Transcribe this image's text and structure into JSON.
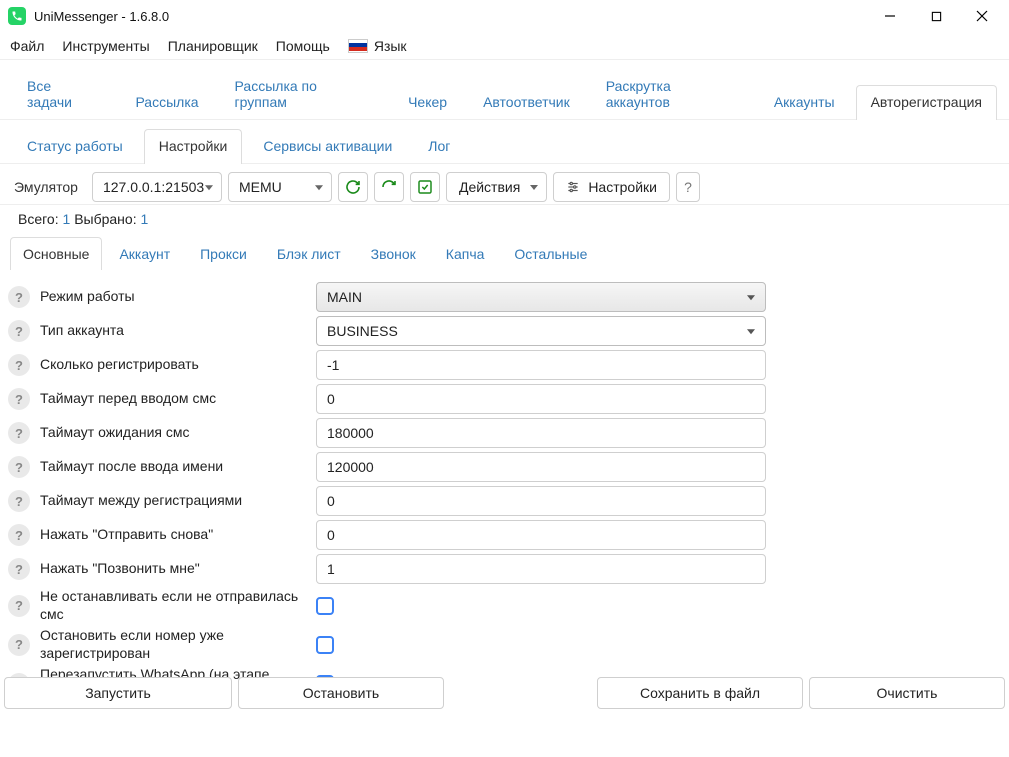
{
  "window": {
    "title": "UniMessenger - 1.6.8.0"
  },
  "menubar": {
    "file": "Файл",
    "tools": "Инструменты",
    "scheduler": "Планировщик",
    "help": "Помощь",
    "lang": "Язык"
  },
  "tabs_primary": {
    "all": "Все задачи",
    "mailing": "Рассылка",
    "group_mailing": "Рассылка по группам",
    "checker": "Чекер",
    "autoresponder": "Автоответчик",
    "promotion": "Раскрутка аккаунтов",
    "accounts": "Аккаунты",
    "autoreg": "Авторегистрация"
  },
  "tabs_secondary": {
    "status": "Статус работы",
    "settings": "Настройки",
    "activation": "Сервисы активации",
    "log": "Лог"
  },
  "toolbar": {
    "emulator_label": "Эмулятор",
    "address": "127.0.0.1:21503",
    "emulator_type": "MEMU",
    "actions": "Действия",
    "settings": "Настройки",
    "help": "?"
  },
  "totals": {
    "prefix": "Всего:",
    "total": "1",
    "sel_prefix": "Выбрано:",
    "selected": "1"
  },
  "subtabs": {
    "main": "Основные",
    "account": "Аккаунт",
    "proxy": "Прокси",
    "blacklist": "Блэк лист",
    "call": "Звонок",
    "captcha": "Капча",
    "other": "Остальные"
  },
  "form": {
    "mode_label": "Режим работы",
    "mode_value": "MAIN",
    "acct_type_label": "Тип аккаунта",
    "acct_type_value": "BUSINESS",
    "reg_count_label": "Сколько регистрировать",
    "reg_count_value": "-1",
    "timeout_before_sms_label": "Таймаут перед вводом смс",
    "timeout_before_sms_value": "0",
    "timeout_wait_sms_label": "Таймаут ожидания смс",
    "timeout_wait_sms_value": "180000",
    "timeout_after_name_label": "Таймаут после ввода имени",
    "timeout_after_name_value": "120000",
    "timeout_between_label": "Таймаут между регистрациями",
    "timeout_between_value": "0",
    "press_resend_label": "Нажать \"Отправить снова\"",
    "press_resend_value": "0",
    "press_call_label": "Нажать \"Позвонить мне\"",
    "press_call_value": "1",
    "no_stop_sms_label": "Не останавливать если не отправилась смс",
    "stop_if_registered_label": "Остановить если номер уже зарегистрирован",
    "restart_wa_label": "Перезапустить WhatsApp (на этапе ожидания смс)"
  },
  "footer": {
    "start": "Запустить",
    "stop": "Остановить",
    "save": "Сохранить в файл",
    "clear": "Очистить"
  }
}
